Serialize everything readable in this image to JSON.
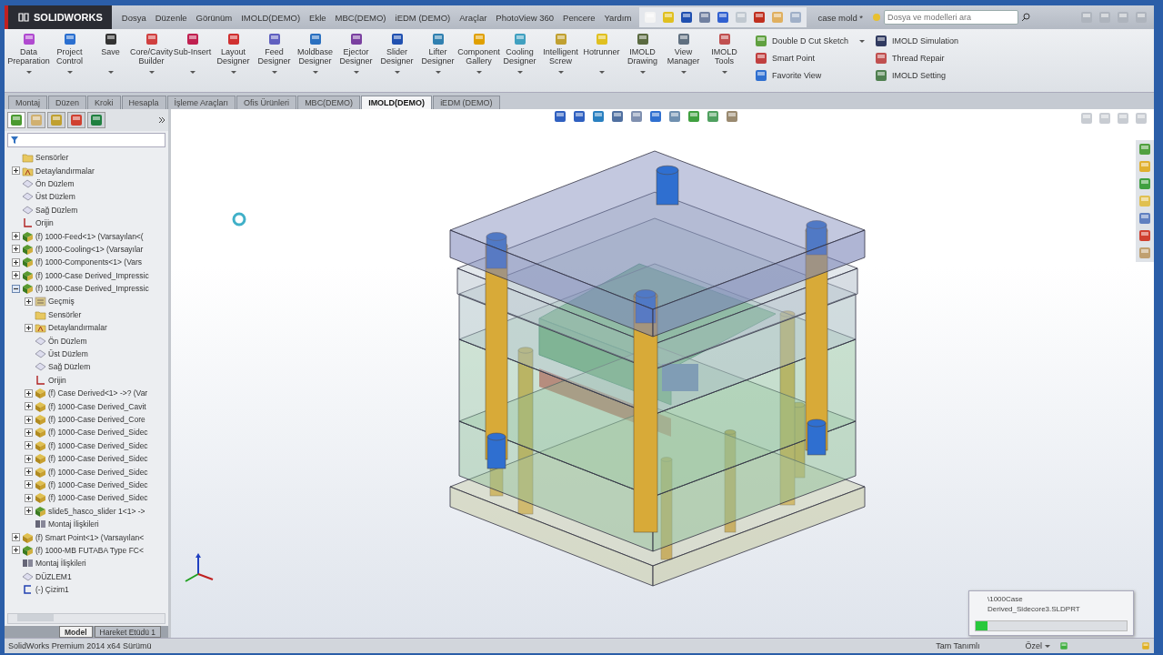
{
  "app": {
    "logo": "SOLIDWORKS"
  },
  "menu": [
    "Dosya",
    "Düzenle",
    "Görünüm",
    "IMOLD(DEMO)",
    "Ekle",
    "MBC(DEMO)",
    "iEDM (DEMO)",
    "Araçlar",
    "PhotoView 360",
    "Pencere",
    "Yardım"
  ],
  "document_title": "case mold *",
  "search": {
    "placeholder": "Dosya ve modelleri ara"
  },
  "ribbon": {
    "large_buttons": [
      "Data Preparation",
      "Project Control",
      "Save",
      "Core/Cavity Builder",
      "Sub-Insert",
      "Layout Designer",
      "Feed Designer",
      "Moldbase Designer",
      "Ejector Designer",
      "Slider Designer",
      "Lifter Designer",
      "Component Gallery",
      "Cooling Designer",
      "Intelligent Screw",
      "Hotrunner",
      "IMOLD Drawing",
      "View Manager",
      "IMOLD Tools"
    ],
    "small_buttons": [
      {
        "label": "Double D Cut Sketch",
        "dropdown": true
      },
      {
        "label": "Smart Point",
        "dropdown": false
      },
      {
        "label": "Favorite View",
        "dropdown": false
      },
      {
        "label": "IMOLD Simulation",
        "dropdown": false
      },
      {
        "label": "Thread Repair",
        "dropdown": false
      },
      {
        "label": "IMOLD Setting",
        "dropdown": false
      }
    ]
  },
  "command_tabs": [
    {
      "label": "Montaj",
      "selected": false
    },
    {
      "label": "Düzen",
      "selected": false
    },
    {
      "label": "Kroki",
      "selected": false
    },
    {
      "label": "Hesapla",
      "selected": false
    },
    {
      "label": "İşleme Araçları",
      "selected": false
    },
    {
      "label": "Ofis Ürünleri",
      "selected": false
    },
    {
      "label": "MBC(DEMO)",
      "selected": false
    },
    {
      "label": "IMOLD(DEMO)",
      "selected": true
    },
    {
      "label": "iEDM (DEMO)",
      "selected": false
    }
  ],
  "panel_tabs": [
    {
      "kind": "tree",
      "selected": true
    },
    {
      "kind": "properties",
      "selected": false
    },
    {
      "kind": "config",
      "selected": false
    },
    {
      "kind": "dim",
      "selected": false
    },
    {
      "kind": "display",
      "selected": false
    }
  ],
  "tree": [
    {
      "label": "Sensörler",
      "kind": "folder"
    },
    {
      "label": "Detaylandırmalar",
      "kind": "annotation",
      "expanded": false
    },
    {
      "label": "Ön Düzlem",
      "kind": "plane"
    },
    {
      "label": "Üst Düzlem",
      "kind": "plane"
    },
    {
      "label": "Sağ Düzlem",
      "kind": "plane"
    },
    {
      "label": "Orijin",
      "kind": "origin"
    },
    {
      "label": "(f) 1000-Feed<1> (Varsayılan<(",
      "kind": "assembly",
      "expanded": false
    },
    {
      "label": "(f) 1000-Cooling<1> (Varsayılar",
      "kind": "assembly",
      "expanded": false
    },
    {
      "label": "(f) 1000-Components<1> (Vars",
      "kind": "assembly",
      "expanded": false
    },
    {
      "label": "(f) 1000-Case Derived_Impressic",
      "kind": "assembly",
      "expanded": false
    },
    {
      "label": "(f) 1000-Case Derived_Impressic",
      "kind": "assembly",
      "expanded": true,
      "children": [
        {
          "label": "Geçmiş",
          "kind": "history",
          "expanded": false
        },
        {
          "label": "Sensörler",
          "kind": "folder"
        },
        {
          "label": "Detaylandırmalar",
          "kind": "annotation",
          "expanded": false
        },
        {
          "label": "Ön Düzlem",
          "kind": "plane"
        },
        {
          "label": "Üst Düzlem",
          "kind": "plane"
        },
        {
          "label": "Sağ Düzlem",
          "kind": "plane"
        },
        {
          "label": "Orijin",
          "kind": "origin"
        },
        {
          "label": "(f) Case Derived<1> ->? (Var",
          "kind": "part",
          "expanded": false
        },
        {
          "label": "(f) 1000-Case Derived_Cavit",
          "kind": "part",
          "expanded": false
        },
        {
          "label": "(f) 1000-Case Derived_Core",
          "kind": "part",
          "expanded": false
        },
        {
          "label": "(f) 1000-Case Derived_Sidec",
          "kind": "part",
          "expanded": false
        },
        {
          "label": "(f) 1000-Case Derived_Sidec",
          "kind": "part",
          "expanded": false
        },
        {
          "label": "(f) 1000-Case Derived_Sidec",
          "kind": "part",
          "expanded": false
        },
        {
          "label": "(f) 1000-Case Derived_Sidec",
          "kind": "part",
          "expanded": false
        },
        {
          "label": "(f) 1000-Case Derived_Sidec",
          "kind": "part",
          "expanded": false
        },
        {
          "label": "(f) 1000-Case Derived_Sidec",
          "kind": "part",
          "expanded": false
        },
        {
          "label": "slide5_hasco_slider 1<1> ->",
          "kind": "assembly",
          "expanded": false
        },
        {
          "label": "Montaj İlişkileri",
          "kind": "mates"
        }
      ]
    },
    {
      "label": "(f) Smart Point<1> (Varsayılan<",
      "kind": "part",
      "expanded": false
    },
    {
      "label": "(f) 1000-MB FUTABA Type FC<",
      "kind": "assembly",
      "expanded": false
    },
    {
      "label": "Montaj İlişkileri",
      "kind": "mates"
    },
    {
      "label": "DÜZLEM1",
      "kind": "plane"
    },
    {
      "label": "(-) Çizim1",
      "kind": "sketch"
    }
  ],
  "bottom_tabs": [
    {
      "label": "Model",
      "selected": true
    },
    {
      "label": "Hareket Etüdü 1",
      "selected": false
    }
  ],
  "progress": {
    "lines": [
      "\\1000Case",
      "Derived_Sidecore3.SLDPRT"
    ],
    "level": 0.08
  },
  "status_bar": {
    "product": "SolidWorks Premium 2014 x64 Sürümü",
    "state": "Tam Tanımlı",
    "units": "Özel"
  }
}
